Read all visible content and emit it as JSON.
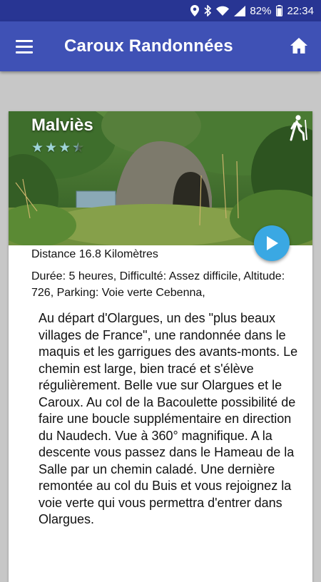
{
  "status_bar": {
    "battery_percent": "82%",
    "time": "22:34",
    "icons": [
      "location-icon",
      "bluetooth-icon",
      "wifi-icon",
      "signal-icon",
      "battery-icon"
    ]
  },
  "app_bar": {
    "title": "Caroux Randonnées",
    "menu_icon": "hamburger-menu-icon",
    "home_icon": "home-icon"
  },
  "hike": {
    "name": "Malviès",
    "rating": 3.5,
    "rating_max": 5,
    "distance": "Distance 16.8 Kilomètres",
    "details": "Durée: 5 heures, Difficulté: Assez difficile, Altitude: 726, Parking: Voie verte Cebenna,",
    "description": "Au départ d'Olargues, un des \"plus beaux villages de France\", une randonnée dans le maquis et les garrigues des avants-monts. Le chemin est large, bien tracé et s'élève régulièrement. Belle vue sur Olargues et le Caroux. Au col de la Bacoulette possibilité de faire une boucle supplémentaire en direction du Naudech. Vue à 360° magnifique. A la descente vous passez dans le Hameau de la Salle par un chemin caladé. Une dernière remontée au col du Buis et vous rejoignez la voie verte qui vous permettra d'entrer dans Olargues."
  },
  "colors": {
    "status_bar": "#283593",
    "app_bar": "#3f51b5",
    "play_button": "#3aa8e3",
    "background": "#c7c7c7"
  }
}
